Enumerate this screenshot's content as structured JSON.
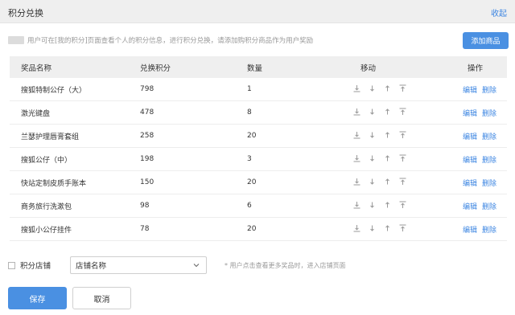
{
  "header": {
    "title": "积分兑换",
    "collapse_label": "收起"
  },
  "tip": {
    "text": "用户可在[我的积分]页面查看个人的积分信息，进行积分兑换，请添加购积分商品作为用户奖励"
  },
  "toolbar": {
    "add_label": "添加商品"
  },
  "table": {
    "headers": {
      "name": "奖品名称",
      "points": "兑换积分",
      "qty": "数量",
      "move": "移动",
      "op": "操作"
    },
    "rows": [
      {
        "name": "搜狐特制公仔（大）",
        "points": "798",
        "qty": "1"
      },
      {
        "name": "激光键盘",
        "points": "478",
        "qty": "8"
      },
      {
        "name": "兰瑟护理唇膏套组",
        "points": "258",
        "qty": "20"
      },
      {
        "name": "搜狐公仔（中）",
        "points": "198",
        "qty": "3"
      },
      {
        "name": "快站定制皮质手账本",
        "points": "150",
        "qty": "20"
      },
      {
        "name": "商务旅行洗漱包",
        "points": "98",
        "qty": "6"
      },
      {
        "name": "搜狐小公仔挂件",
        "points": "78",
        "qty": "20"
      }
    ],
    "edit_label": "编辑",
    "delete_label": "删除"
  },
  "shop": {
    "label": "积分店铺",
    "select_value": "店铺名称",
    "hint": "* 用户点击查看更多奖品时，进入店铺页面"
  },
  "actions": {
    "save_label": "保存",
    "cancel_label": "取消"
  },
  "colors": {
    "accent": "#4a90e2",
    "link": "#3d86e2",
    "header_bg": "#efefef"
  }
}
